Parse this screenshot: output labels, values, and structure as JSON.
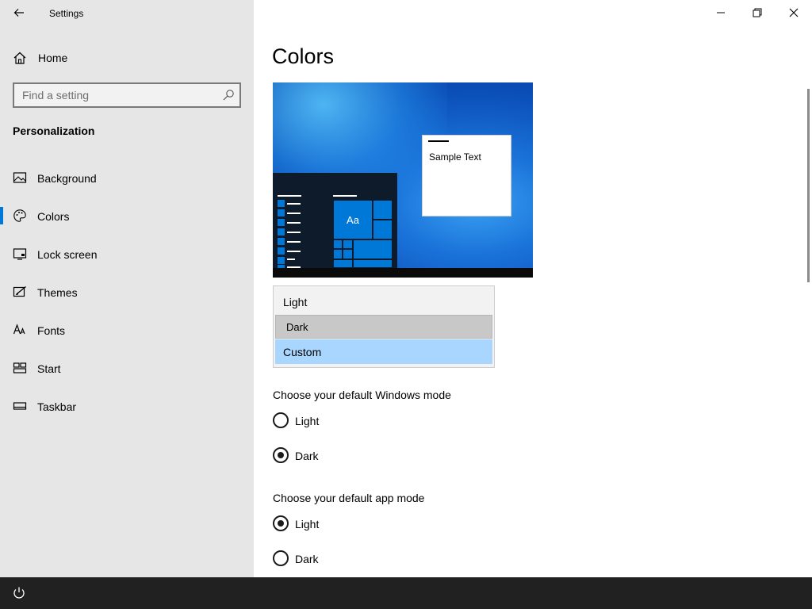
{
  "window": {
    "title": "Settings",
    "controls": {
      "minimize": "minimize-icon",
      "restore": "restore-icon",
      "close": "close-icon"
    }
  },
  "sidebar": {
    "home_label": "Home",
    "search_placeholder": "Find a setting",
    "section_title": "Personalization",
    "items": [
      {
        "label": "Background",
        "icon": "picture-icon"
      },
      {
        "label": "Colors",
        "icon": "palette-icon",
        "selected": true
      },
      {
        "label": "Lock screen",
        "icon": "lock-screen-icon"
      },
      {
        "label": "Themes",
        "icon": "themes-icon"
      },
      {
        "label": "Fonts",
        "icon": "fonts-icon"
      },
      {
        "label": "Start",
        "icon": "start-icon"
      },
      {
        "label": "Taskbar",
        "icon": "taskbar-icon"
      }
    ]
  },
  "main": {
    "title": "Colors",
    "preview": {
      "tile_text": "Aa",
      "sample_text": "Sample Text"
    },
    "color_dropdown": {
      "options": [
        "Light",
        "Dark",
        "Custom"
      ],
      "selected": "Custom",
      "hovered": "Dark"
    },
    "windows_mode": {
      "label": "Choose your default Windows mode",
      "options": [
        "Light",
        "Dark"
      ],
      "selected": "Dark"
    },
    "app_mode": {
      "label": "Choose your default app mode",
      "options": [
        "Light",
        "Dark"
      ],
      "selected": "Light"
    }
  },
  "colors": {
    "accent": "#0078d7",
    "sidebar_bg": "#e6e6e6",
    "dropdown_selected": "#a9d6ff",
    "dropdown_hover": "#c8c8c8",
    "taskbar_bg": "#212121"
  },
  "taskbar": {
    "icon": "power-icon"
  }
}
